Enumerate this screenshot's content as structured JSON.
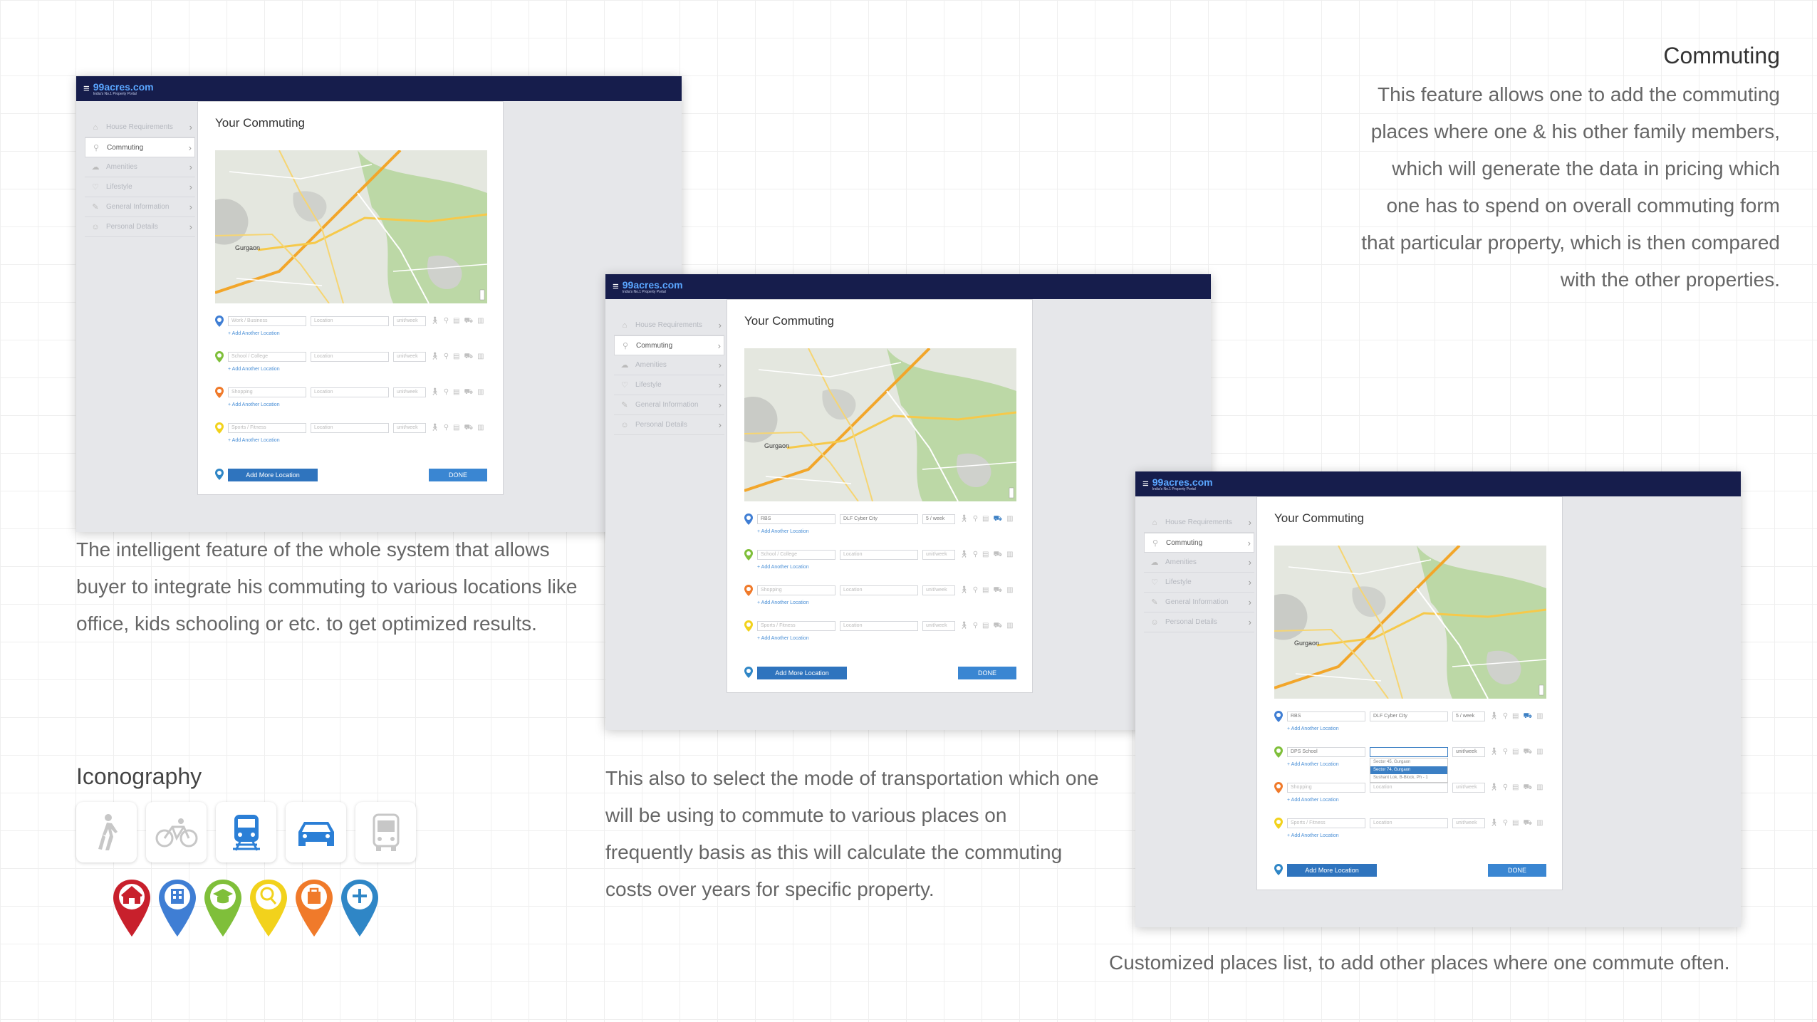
{
  "commuting_section": {
    "heading": "Commuting",
    "lines": [
      "This feature allows one to add the commuting",
      "places where one & his other family  members,",
      "which will generate the data in pricing  which",
      "one has to spend on overall commuting form",
      "that particular property, which is then compared",
      "with the other properties."
    ]
  },
  "intelligent_text": {
    "lines": [
      "The intelligent feature of the whole system that allows",
      "buyer to integrate his commuting to various locations like",
      "office, kids schooling or etc. to get optimized results."
    ]
  },
  "transport_text": {
    "lines": [
      "This also to select the mode of transportation which one",
      "will be using to commute to various places on",
      "frequently basis as this will calculate the commuting",
      "costs over years for specific property."
    ]
  },
  "custom_caption": "Customized places list, to add other places where one commute often.",
  "iconography": {
    "heading": "Iconography",
    "mode_icons": [
      "walk-icon",
      "bicycle-icon",
      "train-icon",
      "car-icon",
      "bus-icon"
    ],
    "place_pins": [
      {
        "name": "home-pin-icon",
        "color": "#c8202c"
      },
      {
        "name": "office-pin-icon",
        "color": "#3f7ed4"
      },
      {
        "name": "school-pin-icon",
        "color": "#7fbf3a"
      },
      {
        "name": "sports-pin-icon",
        "color": "#f2d21c"
      },
      {
        "name": "shopping-pin-icon",
        "color": "#f07a2a"
      },
      {
        "name": "add-pin-icon",
        "color": "#2f86c6"
      }
    ]
  },
  "app": {
    "logo": "99acres.com",
    "tagline": "India's No.1 Property Portal",
    "panel_title": "Your Commuting",
    "sidebar": [
      "House Requirements",
      "Commuting",
      "Amenities",
      "Lifestyle",
      "General Information",
      "Personal Details"
    ],
    "map_city": "Gurgaon",
    "add_another": "Add Another Location",
    "add_more": "Add More Location",
    "done_label": "DONE"
  },
  "screens": [
    {
      "rows": [
        {
          "pin_color": "#3f7ed4",
          "place": "Work / Business",
          "place_filled": false,
          "location": "Location",
          "location_filled": false,
          "freq": "unit/week"
        },
        {
          "pin_color": "#7fbf3a",
          "place": "School / College",
          "place_filled": false,
          "location": "Location",
          "location_filled": false,
          "freq": "unit/week"
        },
        {
          "pin_color": "#f07a2a",
          "place": "Shopping",
          "place_filled": false,
          "location": "Location",
          "location_filled": false,
          "freq": "unit/week"
        },
        {
          "pin_color": "#f2d21c",
          "place": "Sports / Fitness",
          "place_filled": false,
          "location": "Location",
          "location_filled": false,
          "freq": "unit/week"
        }
      ]
    },
    {
      "done_label": "DONE",
      "rows": [
        {
          "pin_color": "#3f7ed4",
          "place": "RBS",
          "place_filled": true,
          "location": "DLF Cyber City",
          "location_filled": true,
          "freq": "5 / week",
          "active_mode": "car"
        },
        {
          "pin_color": "#7fbf3a",
          "place": "School / College",
          "place_filled": false,
          "location": "Location",
          "location_filled": false,
          "freq": "unit/week"
        },
        {
          "pin_color": "#f07a2a",
          "place": "Shopping",
          "place_filled": false,
          "location": "Location",
          "location_filled": false,
          "freq": "unit/week"
        },
        {
          "pin_color": "#f2d21c",
          "place": "Sports / Fitness",
          "place_filled": false,
          "location": "Location",
          "location_filled": false,
          "freq": "unit/week"
        }
      ]
    },
    {
      "rows": [
        {
          "pin_color": "#3f7ed4",
          "place": "RBS",
          "place_filled": true,
          "location": "DLF Cyber City",
          "location_filled": true,
          "freq": "5 / week",
          "active_mode": "car"
        },
        {
          "pin_color": "#7fbf3a",
          "place": "DPS School",
          "place_filled": true,
          "location": "",
          "location_filled": true,
          "location_focus": true,
          "freq": "unit/week",
          "dropdown": [
            "Sector 45, Gurgaon",
            "Sector 74, Gurgaon",
            "Sushant Lok, B-Block, Ph - 1"
          ],
          "dropdown_selected": 1
        },
        {
          "pin_color": "#f07a2a",
          "place": "Shopping",
          "place_filled": false,
          "location": "Location",
          "location_filled": false,
          "freq": "unit/week"
        },
        {
          "pin_color": "#f2d21c",
          "place": "Sports / Fitness",
          "place_filled": false,
          "location": "Location",
          "location_filled": false,
          "freq": "unit/week"
        }
      ]
    }
  ]
}
